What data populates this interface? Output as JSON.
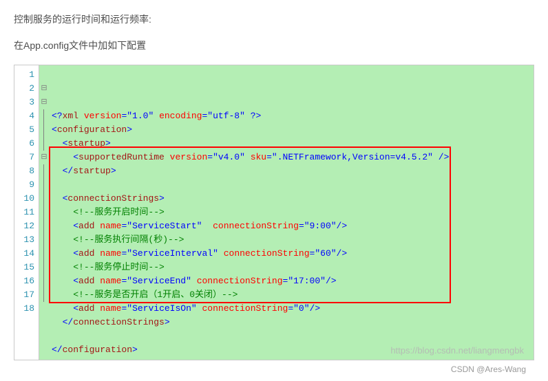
{
  "intro": {
    "p1": "控制服务的运行时间和运行频率:",
    "p2": "在App.config文件中加如下配置"
  },
  "code": {
    "lines": [
      {
        "n": 1,
        "fold": "",
        "html": "<span class='c-blue'>&lt;?</span><span class='c-maroon'>xml</span> <span class='c-red'>version</span><span class='c-blue'>=\"1.0\"</span> <span class='c-red'>encoding</span><span class='c-blue'>=\"utf-8\"</span> <span class='c-blue'>?&gt;</span>"
      },
      {
        "n": 2,
        "fold": "⊟",
        "html": "<span class='c-blue'>&lt;</span><span class='c-maroon'>configuration</span><span class='c-blue'>&gt;</span>"
      },
      {
        "n": 3,
        "fold": "⊟",
        "html": "  <span class='c-blue'>&lt;</span><span class='c-maroon'>startup</span><span class='c-blue'>&gt;</span>"
      },
      {
        "n": 4,
        "fold": "|",
        "html": "    <span class='c-blue'>&lt;</span><span class='c-maroon'>supportedRuntime</span> <span class='c-red'>version</span><span class='c-blue'>=\"v4.0\"</span> <span class='c-red'>sku</span><span class='c-blue'>=\".NETFramework,Version=v4.5.2\"</span> <span class='c-blue'>/&gt;</span>"
      },
      {
        "n": 5,
        "fold": "|",
        "html": "  <span class='c-blue'>&lt;/</span><span class='c-maroon'>startup</span><span class='c-blue'>&gt;</span>"
      },
      {
        "n": 6,
        "fold": "|",
        "html": ""
      },
      {
        "n": 7,
        "fold": "⊟",
        "html": "  <span class='c-blue'>&lt;</span><span class='c-maroon'>connectionStrings</span><span class='c-blue'>&gt;</span>"
      },
      {
        "n": 8,
        "fold": "|",
        "html": "    <span class='c-green'>&lt;!--服务开启时间--&gt;</span>"
      },
      {
        "n": 9,
        "fold": "|",
        "html": "    <span class='c-blue'>&lt;</span><span class='c-maroon'>add</span> <span class='c-red'>name</span><span class='c-blue'>=\"ServiceStart\"</span>  <span class='c-red'>connectionString</span><span class='c-blue'>=\"9:00\"/&gt;</span>"
      },
      {
        "n": 10,
        "fold": "|",
        "html": "    <span class='c-green'>&lt;!--服务执行间隔(秒)--&gt;</span>"
      },
      {
        "n": 11,
        "fold": "|",
        "html": "    <span class='c-blue'>&lt;</span><span class='c-maroon'>add</span> <span class='c-red'>name</span><span class='c-blue'>=\"ServiceInterval\"</span> <span class='c-red'>connectionString</span><span class='c-blue'>=\"60\"/&gt;</span>"
      },
      {
        "n": 12,
        "fold": "|",
        "html": "    <span class='c-green'>&lt;!--服务停止时间--&gt;</span>"
      },
      {
        "n": 13,
        "fold": "|",
        "html": "    <span class='c-blue'>&lt;</span><span class='c-maroon'>add</span> <span class='c-red'>name</span><span class='c-blue'>=\"ServiceEnd\"</span> <span class='c-red'>connectionString</span><span class='c-blue'>=\"17:00\"/&gt;</span>"
      },
      {
        "n": 14,
        "fold": "|",
        "html": "    <span class='c-green'>&lt;!--服务是否开启（1开启、0关闭）--&gt;</span>"
      },
      {
        "n": 15,
        "fold": "|",
        "html": "    <span class='c-blue'>&lt;</span><span class='c-maroon'>add</span> <span class='c-red'>name</span><span class='c-blue'>=\"ServiceIsOn\"</span> <span class='c-red'>connectionString</span><span class='c-blue'>=\"0\"/&gt;</span>"
      },
      {
        "n": 16,
        "fold": "|",
        "html": "  <span class='c-blue'>&lt;/</span><span class='c-maroon'>connectionStrings</span><span class='c-blue'>&gt;</span>"
      },
      {
        "n": 17,
        "fold": "|",
        "html": ""
      },
      {
        "n": 18,
        "fold": "",
        "html": "<span class='c-blue'>&lt;/</span><span class='c-maroon'>configuration</span><span class='c-blue'>&gt;</span>"
      }
    ],
    "highlight": {
      "startLine": 7,
      "endLine": 17
    }
  },
  "watermark": "https://blog.csdn.net/liangmengbk",
  "footer": "CSDN @Ares-Wang"
}
